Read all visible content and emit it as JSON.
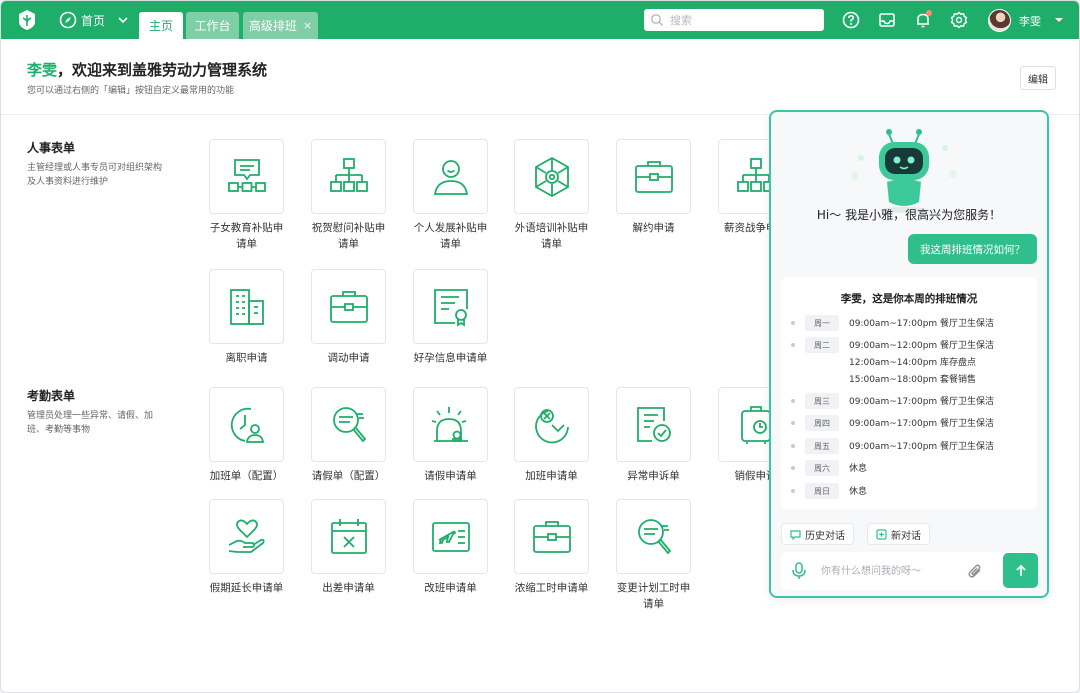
{
  "topbar": {
    "home_label": "首页",
    "tabs": [
      {
        "label": "主页"
      },
      {
        "label": "工作台"
      },
      {
        "label": "高级排班",
        "close": "×"
      }
    ],
    "search_placeholder": "搜索",
    "user_name": "李雯",
    "accent": "#1fae6a"
  },
  "header": {
    "user_name": "李雯",
    "welcome_text": "，欢迎来到盖雅劳动力管理系统",
    "subtitle": "您可以通过右侧的「编辑」按钮自定义最常用的功能",
    "edit_label": "编辑"
  },
  "sections": [
    {
      "title": "人事表单",
      "desc": "主管经理或人事专员可对组织架构及人事资料进行维护",
      "items": [
        {
          "label": "子女教育补贴申请单",
          "icon": "chat-org-icon"
        },
        {
          "label": "祝贺慰问补贴申请单",
          "icon": "org-chart-icon"
        },
        {
          "label": "个人发展补贴申请单",
          "icon": "person-icon"
        },
        {
          "label": "外语培训补贴申请单",
          "icon": "hex-gear-icon"
        },
        {
          "label": "解约申请",
          "icon": "briefcase-icon"
        },
        {
          "label": "薪资战争申请",
          "icon": "org-chart-icon"
        },
        {
          "label": "离职申请",
          "icon": "building-icon"
        },
        {
          "label": "调动申请",
          "icon": "briefcase-icon"
        },
        {
          "label": "好孕信息申请单",
          "icon": "certificate-icon"
        }
      ]
    },
    {
      "title": "考勤表单",
      "desc": "管理员处理一些异常、请假、加班、考勤等事物",
      "items": [
        {
          "label": "加班单（配置）",
          "icon": "clock-person-icon"
        },
        {
          "label": "请假单（配置）",
          "icon": "search-doc-icon"
        },
        {
          "label": "请假申请单",
          "icon": "alarm-light-icon"
        },
        {
          "label": "加班申请单",
          "icon": "clock-x-icon"
        },
        {
          "label": "异常申诉单",
          "icon": "doc-clock-icon"
        },
        {
          "label": "销假申请",
          "icon": "luggage-icon"
        },
        {
          "label": "假期延长申请单",
          "icon": "heart-hand-icon"
        },
        {
          "label": "出差申请单",
          "icon": "calendar-x-icon"
        },
        {
          "label": "改班申请单",
          "icon": "plane-ticket-icon"
        },
        {
          "label": "浓缩工时申请单",
          "icon": "briefcase-icon"
        },
        {
          "label": "变更计划工时申请单",
          "icon": "search-doc-icon"
        }
      ]
    }
  ],
  "chat": {
    "greeting": "Hi～ 我是小雅，很高兴为您服务！",
    "user_message": "我这周排班情况如何？",
    "schedule_title": "李雯，这是你本周的排班情况",
    "schedule": [
      {
        "day": "周一",
        "shifts": [
          "09:00am~17:00pm 餐厅卫生保洁"
        ]
      },
      {
        "day": "周二",
        "shifts": [
          "09:00am~12:00pm 餐厅卫生保洁",
          "12:00am~14:00pm 库存盘点",
          "15:00am~18:00pm 套餐销售"
        ]
      },
      {
        "day": "周三",
        "shifts": [
          "09:00am~17:00pm 餐厅卫生保洁"
        ]
      },
      {
        "day": "周四",
        "shifts": [
          "09:00am~17:00pm 餐厅卫生保洁"
        ]
      },
      {
        "day": "周五",
        "shifts": [
          "09:00am~17:00pm 餐厅卫生保洁"
        ]
      },
      {
        "day": "周六",
        "shifts": [
          "休息"
        ]
      },
      {
        "day": "周日",
        "shifts": [
          "休息"
        ]
      }
    ],
    "history_label": "历史对话",
    "new_label": "新对话",
    "input_placeholder": "你有什么想问我的呀～",
    "accent": "#2fbf8d"
  }
}
